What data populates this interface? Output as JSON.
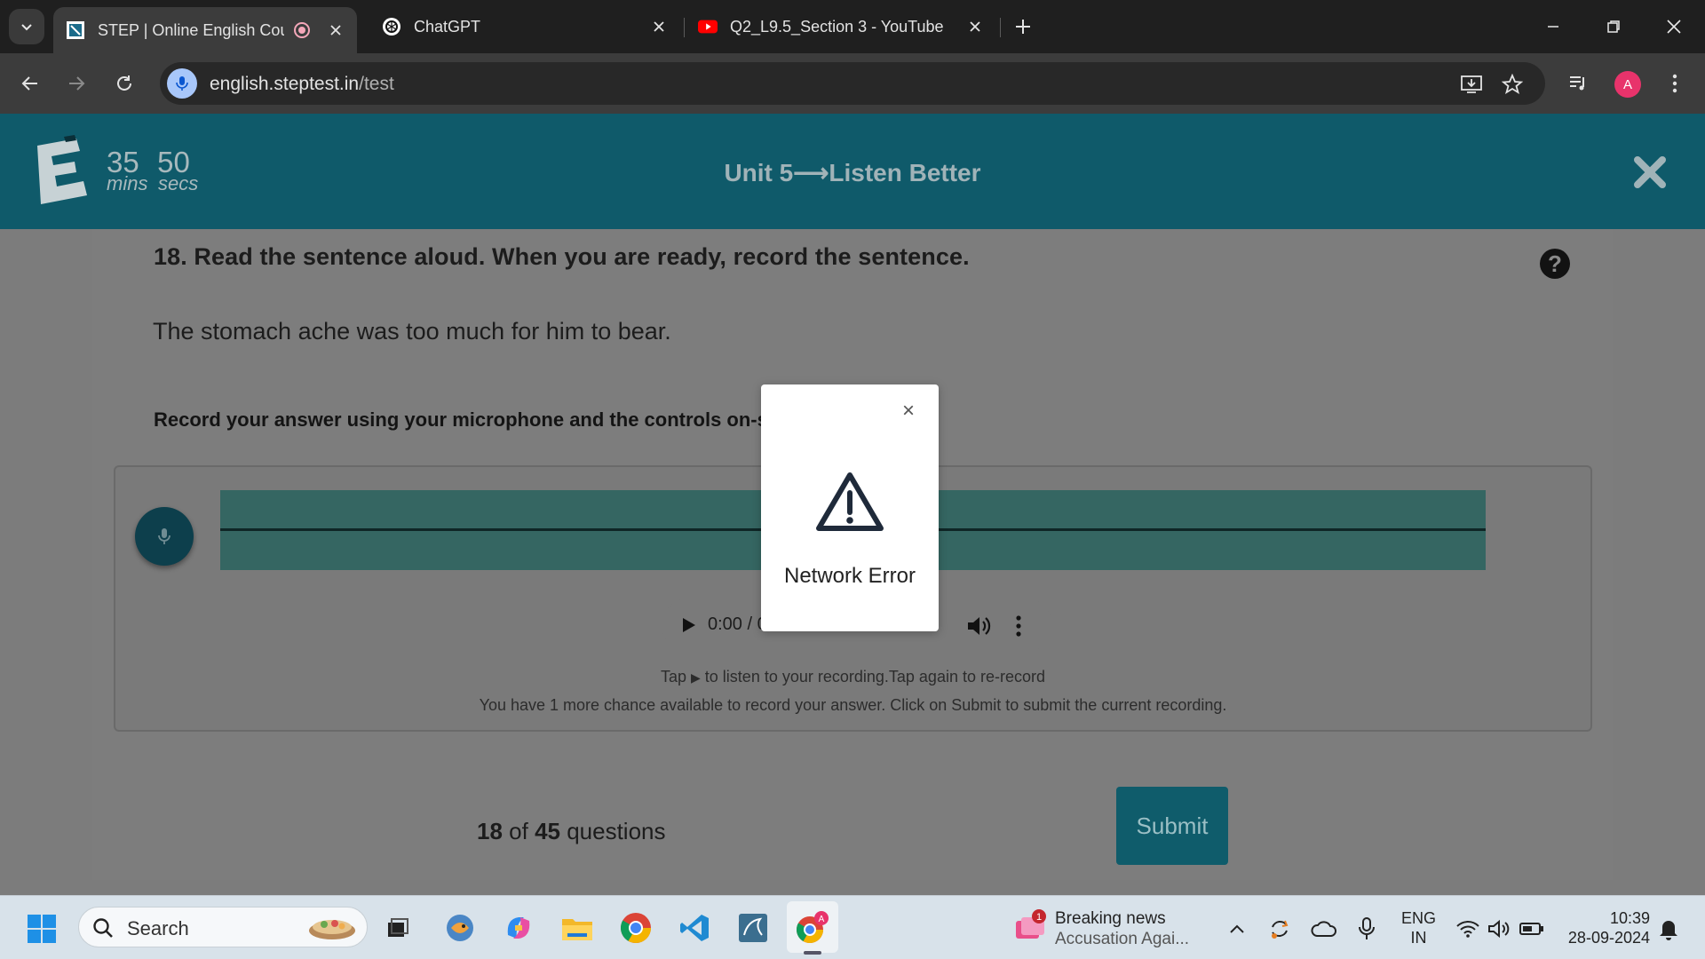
{
  "browser": {
    "tabs": [
      {
        "title": "STEP | Online English Course",
        "active": true
      },
      {
        "title": "ChatGPT",
        "active": false
      },
      {
        "title": "Q2_L9.5_Section 3 - YouTube",
        "active": false
      }
    ],
    "url_host": "english.steptest.in",
    "url_path": "/test",
    "profile_initial": "A"
  },
  "app": {
    "timer_mins": "35",
    "timer_secs": "50",
    "timer_mins_label": "mins",
    "timer_secs_label": "secs",
    "unit_title": "Unit 5⟶Listen Better"
  },
  "question": {
    "title": "18. Read the sentence aloud. When you are ready, record the sentence.",
    "help": "?",
    "sentence": "The stomach ache was too much for him to bear.",
    "instruction": "Record your answer using your microphone and the controls on-scr",
    "audio_time": "0:00 / 0:00",
    "hint_prefix": "Tap ",
    "hint_suffix": " to listen to your recording.Tap again to re-record",
    "chances_text": "You have 1 more chance available to record your answer. Click on Submit to submit the current recording."
  },
  "footer": {
    "current": "18",
    "of_label": " of ",
    "total": "45",
    "questions_label": " questions",
    "submit_label": "Submit"
  },
  "modal": {
    "close": "×",
    "message": "Network Error"
  },
  "taskbar": {
    "search_placeholder": "Search",
    "news_badge": "1",
    "news_title": "Breaking news",
    "news_subtitle": "Accusation Agai...",
    "lang_line1": "ENG",
    "lang_line2": "IN",
    "time": "10:39",
    "date": "28-09-2024"
  },
  "colors": {
    "app_header": "#0f5a6a",
    "overlay_gray": "#7c7c7c",
    "submit_bg": "#0f5c6b",
    "waveform": "#356662",
    "profile": "#e8336b"
  }
}
